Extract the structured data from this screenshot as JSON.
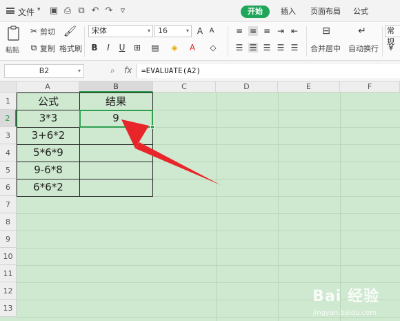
{
  "menubar": {
    "file_label": "文件",
    "tabs": [
      "开始",
      "插入",
      "页面布局",
      "公式"
    ]
  },
  "ribbon": {
    "paste_label": "粘贴",
    "cut_label": "剪切",
    "copy_label": "复制",
    "format_painter_label": "格式刷",
    "font_name": "宋体",
    "font_size": "16",
    "merge_center_label": "合并居中",
    "wrap_text_label": "自动换行",
    "number_format": "常规"
  },
  "formula_bar": {
    "name_box": "B2",
    "fx_label": "fx",
    "formula": "=EVALUATE(A2)"
  },
  "sheet": {
    "columns": [
      "A",
      "B",
      "C",
      "D",
      "E",
      "F"
    ],
    "rows": [
      "1",
      "2",
      "3",
      "4",
      "5",
      "6",
      "7",
      "8",
      "9",
      "10",
      "11",
      "12",
      "13"
    ],
    "header_a": "公式",
    "header_b": "结果",
    "formulas": [
      "3*3",
      "3+6*2",
      "5*6*9",
      "9-6*8",
      "6*6*2"
    ],
    "results": [
      "9",
      "",
      "",
      "",
      ""
    ],
    "selected_cell": "B2"
  },
  "watermark": {
    "brand": "Bai 经验",
    "url": "jingyan.baidu.com"
  },
  "colors": {
    "accent": "#1fa65a",
    "sheet_bg": "#cfe8d0",
    "arrow": "#e8262a"
  }
}
